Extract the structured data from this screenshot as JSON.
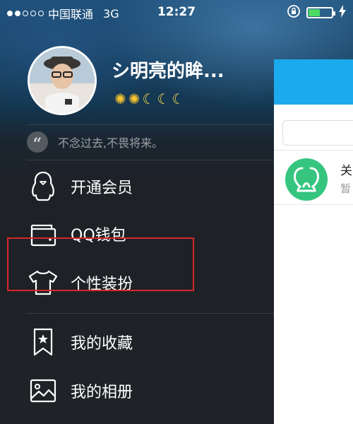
{
  "status_bar": {
    "carrier": "中国联通",
    "network": "3G",
    "time": "12:27",
    "signal_dots_filled": 2,
    "signal_dots_total": 5,
    "battery_level": 0.5,
    "battery_color": "#4cd964"
  },
  "profile": {
    "nickname": "シ明亮的眸...",
    "level_icons": [
      "sun",
      "sun",
      "moon",
      "moon",
      "moon"
    ],
    "signature": "不念过去,不畏将来。"
  },
  "menu": {
    "items": [
      {
        "label": "开通会员",
        "icon": "penguin-icon"
      },
      {
        "label": "QQ钱包",
        "icon": "wallet-icon"
      },
      {
        "label": "个性装扮",
        "icon": "tshirt-icon",
        "highlighted": true
      },
      {
        "label": "我的收藏",
        "icon": "bookmark-star-icon"
      },
      {
        "label": "我的相册",
        "icon": "photo-icon"
      }
    ]
  },
  "main_panel": {
    "header_color": "#1caaee",
    "friend_title": "关",
    "friend_subtitle": "暂"
  },
  "colors": {
    "highlight": "#d8262a",
    "friend_avatar": "#35c57f"
  }
}
